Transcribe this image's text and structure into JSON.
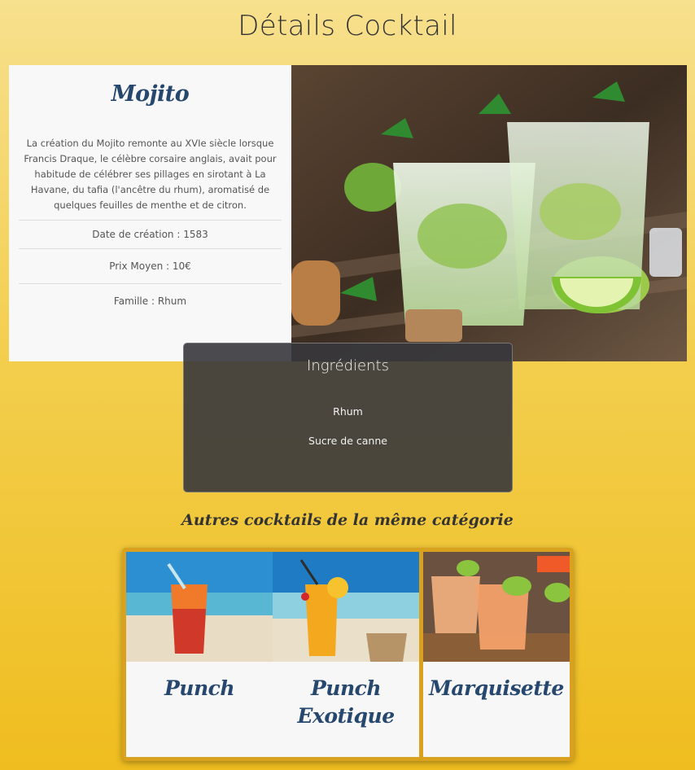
{
  "page": {
    "title": "Détails Cocktail"
  },
  "cocktail": {
    "name": "Mojito",
    "description": "La création du Mojito remonte au XVIe siècle lorsque Francis Draque, le célèbre corsaire anglais, avait pour habitude de célébrer ses pillages en sirotant à La Havane, du tafia (l'ancêtre du rhum), aromatisé de quelques feuilles de menthe et de citron.",
    "creation_date": "Date de création : 1583",
    "average_price": "Prix Moyen : 10€",
    "family": "Famille : Rhum"
  },
  "ingredients": {
    "title": "Ingrédients",
    "items": [
      "Rhum",
      "Sucre de canne"
    ]
  },
  "related": {
    "heading": "Autres cocktails de la même catégorie",
    "items": [
      {
        "name": "Punch"
      },
      {
        "name": "Punch Exotique"
      },
      {
        "name": "Marquisette"
      }
    ]
  },
  "colors": {
    "accent": "#26476e",
    "panel": "#3d3d40",
    "frame": "#d9a11d"
  }
}
